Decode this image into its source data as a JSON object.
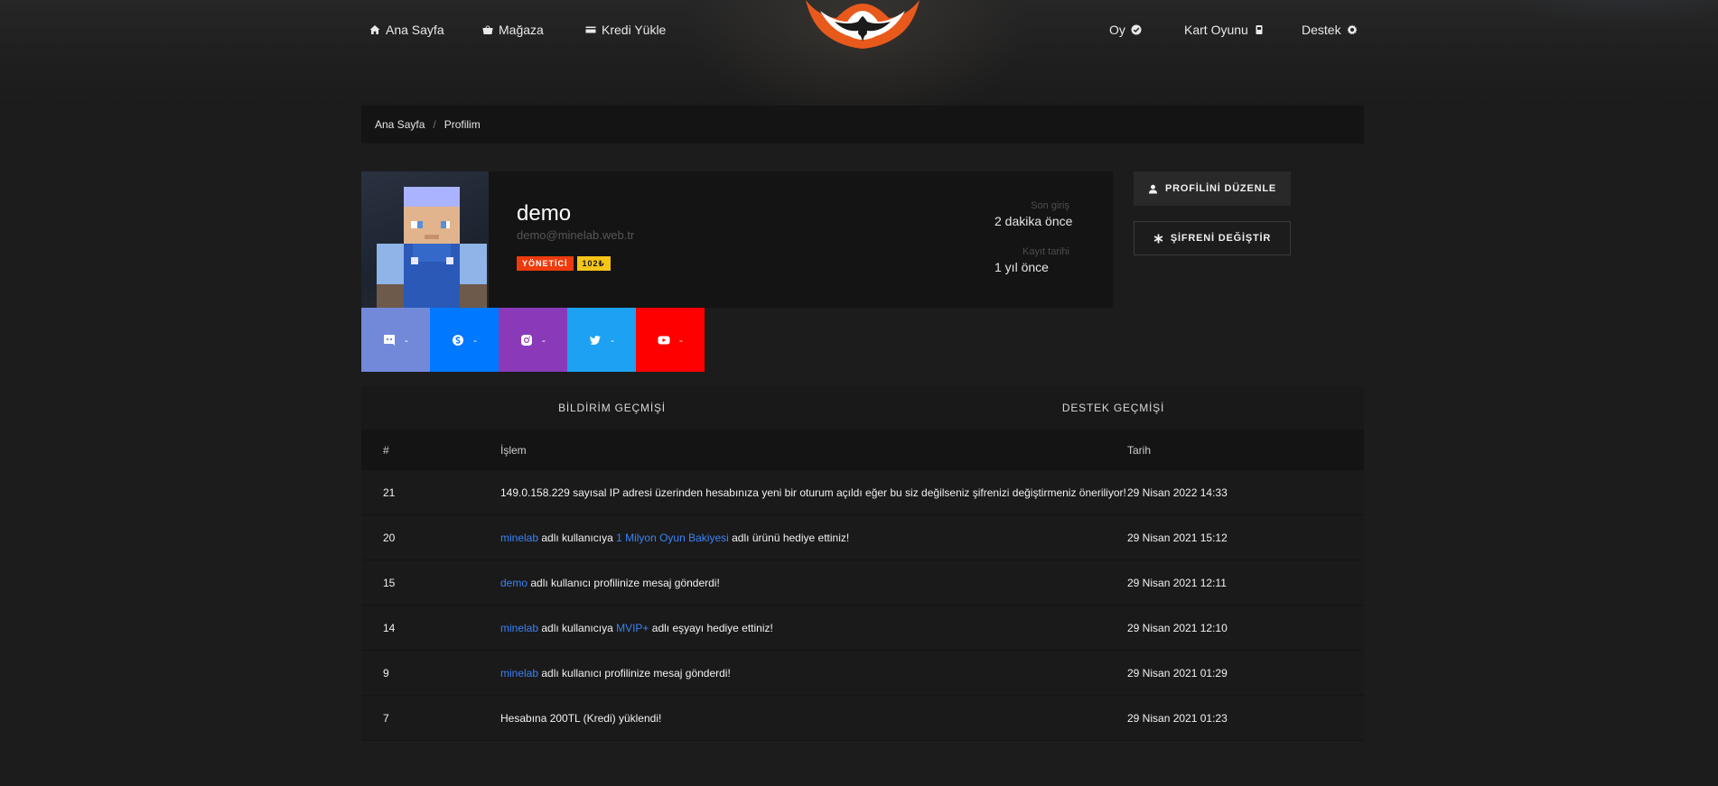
{
  "nav": {
    "left": [
      {
        "label": "Ana Sayfa",
        "icon": "home-icon"
      },
      {
        "label": "Mağaza",
        "icon": "basket-icon"
      },
      {
        "label": "Kredi Yükle",
        "icon": "credit-card-icon"
      }
    ],
    "right": [
      {
        "label": "Oy",
        "icon": "check-circle-icon"
      },
      {
        "label": "Kart Oyunu",
        "icon": "card-game-icon"
      },
      {
        "label": "Destek",
        "icon": "gear-icon"
      }
    ]
  },
  "breadcrumb": {
    "home": "Ana Sayfa",
    "separator": "/",
    "current": "Profilim"
  },
  "profile": {
    "username": "demo",
    "email": "demo@minelab.web.tr",
    "role_badge": "YÖNETİCİ",
    "credit_badge": "102₺",
    "last_login_label": "Son giriş",
    "last_login_value": "2 dakika önce",
    "register_label": "Kayıt tarihi",
    "register_value": "1 yıl önce"
  },
  "actions": {
    "edit_profile": "PROFİLİNİ DÜZENLE",
    "change_password": "ŞİFRENİ DEĞİŞTİR"
  },
  "socials": [
    {
      "name": "discord",
      "value": "-",
      "color": "#7289da"
    },
    {
      "name": "skype",
      "value": "-",
      "color": "#0078ff"
    },
    {
      "name": "instagram",
      "value": "-",
      "color": "#8a3ab9"
    },
    {
      "name": "twitter",
      "value": "-",
      "color": "#1da1f2"
    },
    {
      "name": "youtube",
      "value": "-",
      "color": "#ff0000"
    }
  ],
  "tabs": [
    "BİLDİRİM GEÇMİŞİ",
    "DESTEK GEÇMİŞİ"
  ],
  "table": {
    "headers": [
      "#",
      "İşlem",
      "Tarih"
    ],
    "rows": [
      {
        "id": "21",
        "parts": [
          {
            "t": "149.0.158.229 sayısal IP adresi üzerinden hesabınıza yeni bir oturum açıldı eğer bu siz değilseniz şifrenizi değiştirmeniz öneriliyor!",
            "link": false
          }
        ],
        "date": "29 Nisan 2022 14:33"
      },
      {
        "id": "20",
        "parts": [
          {
            "t": "minelab",
            "link": true
          },
          {
            "t": " adlı kullanıcıya ",
            "link": false
          },
          {
            "t": "1 Milyon Oyun Bakiyesi",
            "link": true
          },
          {
            "t": " adlı ürünü hediye ettiniz!",
            "link": false
          }
        ],
        "date": "29 Nisan 2021 15:12"
      },
      {
        "id": "15",
        "parts": [
          {
            "t": "demo",
            "link": true
          },
          {
            "t": " adlı kullanıcı profilinize mesaj gönderdi!",
            "link": false
          }
        ],
        "date": "29 Nisan 2021 12:11"
      },
      {
        "id": "14",
        "parts": [
          {
            "t": "minelab",
            "link": true
          },
          {
            "t": " adlı kullanıcıya ",
            "link": false
          },
          {
            "t": "MVIP+",
            "link": true
          },
          {
            "t": " adlı eşyayı hediye ettiniz!",
            "link": false
          }
        ],
        "date": "29 Nisan 2021 12:10"
      },
      {
        "id": "9",
        "parts": [
          {
            "t": "minelab",
            "link": true
          },
          {
            "t": " adlı kullanıcı profilinize mesaj gönderdi!",
            "link": false
          }
        ],
        "date": "29 Nisan 2021 01:29"
      },
      {
        "id": "7",
        "parts": [
          {
            "t": "Hesabına 200TL (Kredi) yüklendi!",
            "link": false
          }
        ],
        "date": "29 Nisan 2021 01:23"
      }
    ]
  }
}
